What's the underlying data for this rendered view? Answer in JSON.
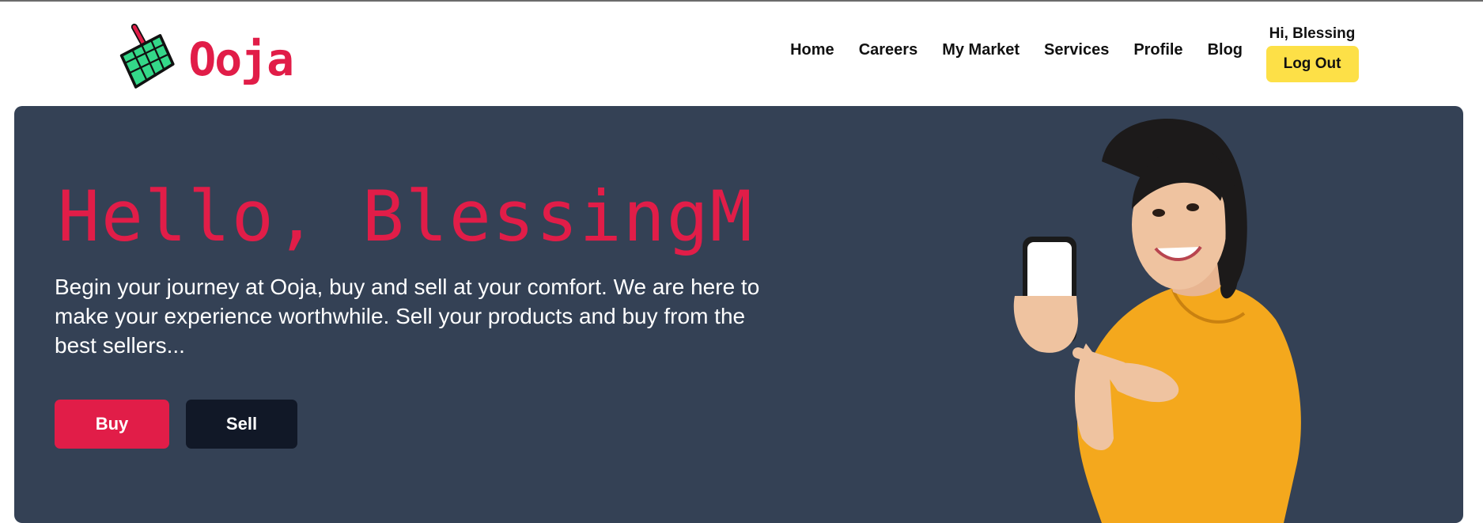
{
  "brand": {
    "name": "Ooja",
    "accent_color": "#e11d48",
    "logo_icon": "shopping-basket-icon"
  },
  "nav": {
    "links": [
      "Home",
      "Careers",
      "My Market",
      "Services",
      "Profile",
      "Blog"
    ]
  },
  "user": {
    "greeting": "Hi, Blessing",
    "logout_label": "Log Out",
    "logout_color": "#fde047"
  },
  "hero": {
    "title": "Hello, BlessingM",
    "description": "Begin your journey at Ooja, buy and sell at your comfort. We are here to make your experience worthwhile. Sell your products and buy from the best sellers...",
    "background_color": "#344155",
    "buy_label": "Buy",
    "sell_label": "Sell",
    "buy_color": "#e11d48",
    "sell_color": "#111827",
    "image": "woman-holding-phone-illustration"
  }
}
